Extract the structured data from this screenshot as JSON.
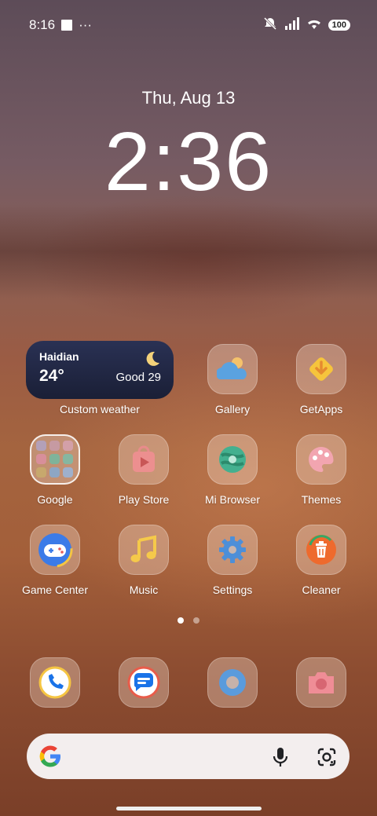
{
  "status_bar": {
    "time": "8:16",
    "more": "···",
    "battery": "100"
  },
  "lockclock": {
    "date": "Thu, Aug 13",
    "time": "2:36"
  },
  "weather_widget": {
    "city": "Haidian",
    "temperature": "24°",
    "air_quality": "Good 29",
    "label": "Custom weather"
  },
  "apps": {
    "gallery": "Gallery",
    "getapps": "GetApps",
    "google": "Google",
    "play_store": "Play Store",
    "mi_browser": "Mi Browser",
    "themes": "Themes",
    "game_center": "Game Center",
    "music": "Music",
    "settings": "Settings",
    "cleaner": "Cleaner"
  },
  "page_indicator": {
    "pages": 2,
    "current": 1
  },
  "dock": {
    "icons": [
      "phone-icon",
      "messages-icon",
      "browser-icon",
      "camera-icon"
    ]
  },
  "search_bar": {
    "icons": [
      "google-logo",
      "mic-icon",
      "lens-icon"
    ]
  }
}
